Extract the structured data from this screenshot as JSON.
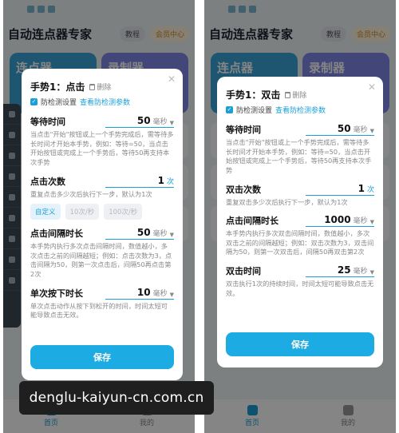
{
  "app": {
    "title": "自动连点器专家",
    "tutorial": "教程",
    "member": "会员中心"
  },
  "bg": {
    "card1": "连点器",
    "card2": "录制器"
  },
  "nav": {
    "home": "首页",
    "mine": "我的"
  },
  "left": {
    "title": "手势1：点击",
    "delete": "删除",
    "anti_detect": "防检测设置",
    "anti_detect_link": "查看防检测参数",
    "wait": {
      "label": "等待时间",
      "value": "50",
      "unit": "毫秒",
      "desc": "当点击\"开始\"按钮或上一个手势完成后，需等待多长时间才开始本手势，例如：等待=50，当点击开始按钮或完成上一个手势后，等待50再支持本次手势"
    },
    "count": {
      "label": "点击次数",
      "value": "1",
      "unit": "次",
      "desc": "重复点击多少次后执行下一步，默认为1次"
    },
    "chips": [
      "自定义",
      "10次/秒",
      "100次/秒"
    ],
    "interval": {
      "label": "点击间隔时长",
      "value": "50",
      "unit": "毫秒",
      "desc": "本手势内执行多次点击间隔时间，数值越小，多次点击之前的间隔越短；例如：点击次数为3，点击间隔为50，则第一次点击后，间隔50再点击第2次"
    },
    "press": {
      "label": "单次按下时长",
      "value": "10",
      "unit": "毫秒",
      "desc": "单次点击动作从按下到松开的时间，时间太短可能导致点击无效。"
    },
    "save": "保存"
  },
  "right": {
    "title": "手势1：双击",
    "delete": "删除",
    "anti_detect": "防检测设置",
    "anti_detect_link": "查看防检测参数",
    "wait": {
      "label": "等待时间",
      "value": "50",
      "unit": "毫秒",
      "desc": "当点击\"开始\"按钮或上一个手势完成后，需等待多长时间才开始本手势，例如：等待=50，当点击开始按钮或完成上一个手势后，等待50再支持本次手势"
    },
    "count": {
      "label": "双击次数",
      "value": "1",
      "unit": "次",
      "desc": "重复双击多少次后执行下一步，默认为1次"
    },
    "interval": {
      "label": "点击间隔时长",
      "value": "1000",
      "unit": "毫秒",
      "desc": "本手势内执行多次双击间隔时间，数值越小，多次双击之前的间隔越短；例如：双击次数为3，双击间隔为50，则第一次双击后，间隔50再双击第2次"
    },
    "dbl": {
      "label": "双击时间",
      "value": "25",
      "unit": "毫秒",
      "desc": "双击执行1次的持续时间，时间太短可能导致点击无效。"
    },
    "save": "保存"
  },
  "watermark": "denglu-kaiyun-cn.com.cn"
}
